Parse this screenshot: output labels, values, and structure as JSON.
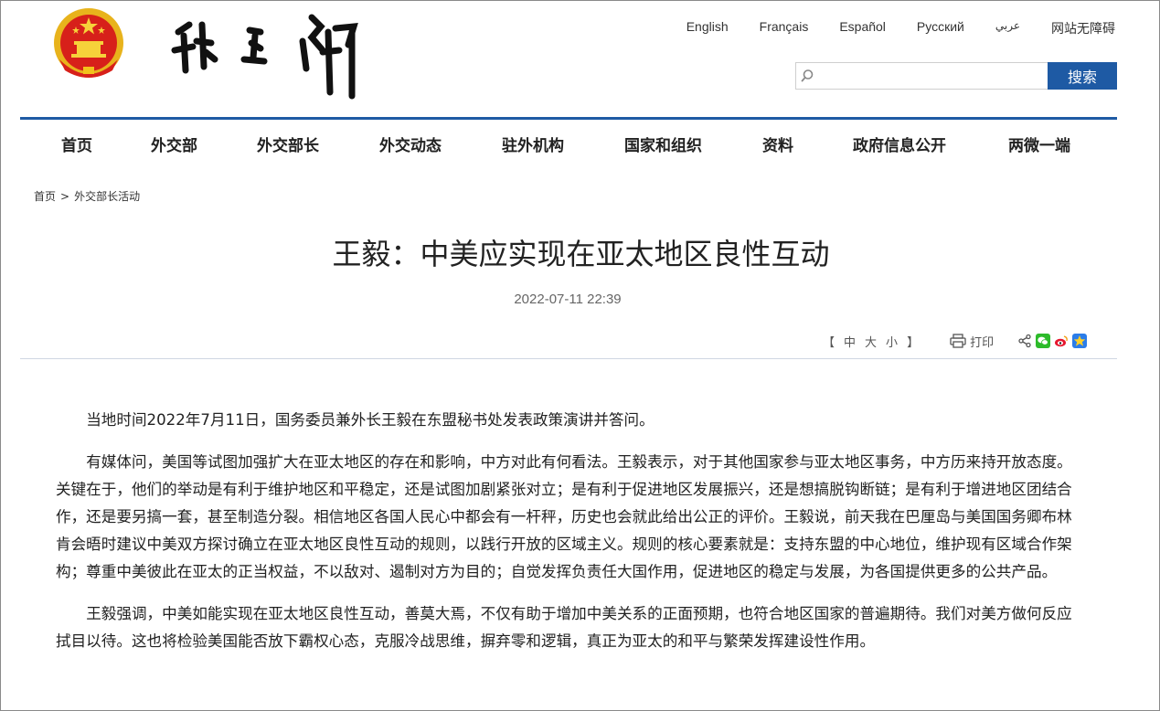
{
  "header": {
    "emblem_icon": "national-emblem-icon",
    "logo_text": "外交部",
    "languages": [
      "English",
      "Français",
      "Español",
      "Русский",
      "عربي",
      "网站无障碍"
    ],
    "search": {
      "placeholder": "",
      "button_label": "搜索"
    }
  },
  "nav": {
    "items": [
      "首页",
      "外交部",
      "外交部长",
      "外交动态",
      "驻外机构",
      "国家和组织",
      "资料",
      "政府信息公开",
      "两微一端"
    ]
  },
  "breadcrumb": {
    "home": "首页",
    "separator": ">",
    "section": "外交部长活动"
  },
  "article": {
    "title": "王毅：中美应实现在亚太地区良性互动",
    "date": "2022-07-11 22:39",
    "font_size": {
      "open": "【",
      "large": "中",
      "medium": "大",
      "small": "小",
      "close": "】"
    },
    "print_label": "打印",
    "share_icons": [
      "share-icon",
      "wechat-icon",
      "weibo-icon",
      "qzone-icon"
    ],
    "paragraphs": [
      "当地时间2022年7月11日，国务委员兼外长王毅在东盟秘书处发表政策演讲并答问。",
      "有媒体问，美国等试图加强扩大在亚太地区的存在和影响，中方对此有何看法。王毅表示，对于其他国家参与亚太地区事务，中方历来持开放态度。关键在于，他们的举动是有利于维护地区和平稳定，还是试图加剧紧张对立；是有利于促进地区发展振兴，还是想搞脱钩断链；是有利于增进地区团结合作，还是要另搞一套，甚至制造分裂。相信地区各国人民心中都会有一杆秤，历史也会就此给出公正的评价。王毅说，前天我在巴厘岛与美国国务卿布林肯会晤时建议中美双方探讨确立在亚太地区良性互动的规则，以践行开放的区域主义。规则的核心要素就是：支持东盟的中心地位，维护现有区域合作架构；尊重中美彼此在亚太的正当权益，不以敌对、遏制对方为目的；自觉发挥负责任大国作用，促进地区的稳定与发展，为各国提供更多的公共产品。",
      "王毅强调，中美如能实现在亚太地区良性互动，善莫大焉，不仅有助于增加中美关系的正面预期，也符合地区国家的普遍期待。我们对美方做何反应拭目以待。这也将检验美国能否放下霸权心态，克服冷战思维，摒弃零和逻辑，真正为亚太的和平与繁荣发挥建设性作用。"
    ]
  },
  "colors": {
    "accent": "#1e5aa4",
    "emblem_red": "#d7201a",
    "emblem_gold": "#f2c21b"
  }
}
